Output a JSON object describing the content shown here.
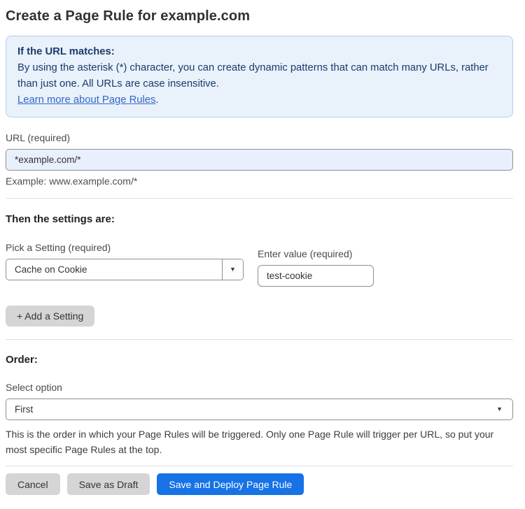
{
  "page": {
    "title": "Create a Page Rule for example.com"
  },
  "info_box": {
    "heading": "If the URL matches:",
    "body": "By using the asterisk (*) character, you can create dynamic patterns that can match many URLs, rather than just one. All URLs are case insensitive.",
    "link_label": "Learn more about Page Rules",
    "link_suffix": "."
  },
  "url_field": {
    "label": "URL (required)",
    "value": "*example.com/*",
    "helper": "Example: www.example.com/*"
  },
  "settings": {
    "heading": "Then the settings are:",
    "setting_label": "Pick a Setting (required)",
    "setting_selected": "Cache on Cookie",
    "value_label": "Enter value (required)",
    "value_text": "test-cookie",
    "add_button_label": "+ Add a Setting"
  },
  "order": {
    "heading": "Order:",
    "select_label": "Select option",
    "selected_option": "First",
    "helper": "This is the order in which your Page Rules will be triggered. Only one Page Rule will trigger per URL, so put your most specific Page Rules at the top."
  },
  "actions": {
    "cancel_label": "Cancel",
    "save_draft_label": "Save as Draft",
    "save_deploy_label": "Save and Deploy Page Rule"
  },
  "colors": {
    "accent_blue": "#1672e6",
    "info_bg": "#e9f1fb",
    "info_border": "#b3d0f0",
    "info_text": "#1b3a6b",
    "link_blue": "#3268c7",
    "input_highlight_bg": "#e8f0fd",
    "input_border": "#8f8f8f",
    "gray_btn_bg": "#d5d5d5",
    "divider": "#e0e0e0"
  }
}
